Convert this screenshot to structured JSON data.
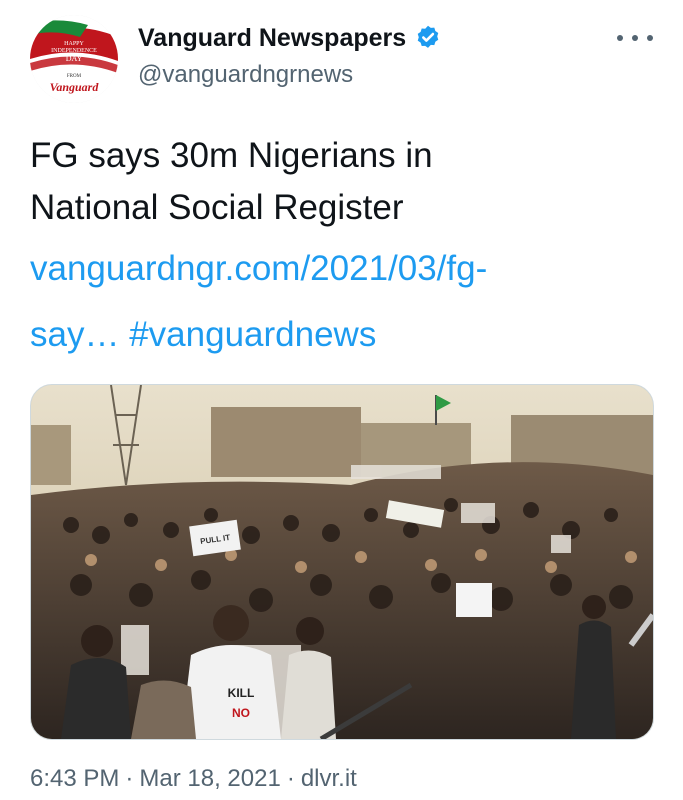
{
  "tweet": {
    "author": {
      "display_name": "Vanguard Newspapers",
      "handle": "@vanguardngrnews",
      "verified": true,
      "avatar_text": {
        "line1": "HAPPY",
        "line2": "INDEPENDENCE",
        "line3": "DAY",
        "line4": "FROM",
        "brand": "Vanguard"
      }
    },
    "more_icon": "more-horizontal-icon",
    "text": {
      "line1": "FG says 30m Nigerians in",
      "line2": "National Social Register",
      "link": "vanguardngr.com/2021/03/fg-",
      "link_cont": "say…",
      "hashtag": "#vanguardnews"
    },
    "media": {
      "banner_texts": {
        "sign1": "PULL IT",
        "sign2": "KILL",
        "sign3": "NO"
      }
    },
    "meta": {
      "time": "6:43 PM",
      "date": "Mar 18, 2021",
      "source": "dlvr.it",
      "separator": "·"
    }
  },
  "colors": {
    "link": "#1d9bf0",
    "secondary_text": "#536471",
    "verified_badge": "#1d9bf0",
    "avatar_red": "#c0161d",
    "avatar_green": "#1a8a3a"
  }
}
